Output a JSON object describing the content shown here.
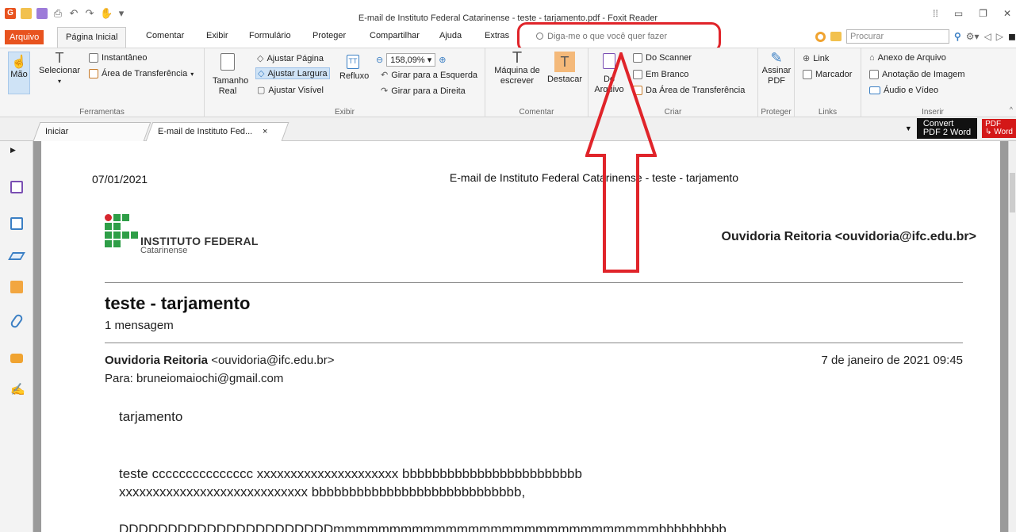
{
  "window": {
    "title": "E-mail de Instituto Federal Catarinense - teste - tarjamento.pdf - Foxit Reader"
  },
  "qat": {
    "app_letter": "G",
    "undo": "↶",
    "redo": "↷",
    "hand": "✋",
    "more": "▾"
  },
  "tabs": {
    "file": "Arquivo",
    "active": "Página Inicial",
    "items": [
      "Comentar",
      "Exibir",
      "Formulário",
      "Proteger",
      "Compartilhar",
      "Ajuda",
      "Extras"
    ],
    "tell_me": "Diga-me o que você quer fazer",
    "search_placeholder": "Procurar"
  },
  "ribbon": {
    "ferramentas": {
      "label": "Ferramentas",
      "mao": "Mão",
      "selecionar": "Selecionar",
      "instantaneo": "Instantâneo",
      "area": "Área de Transferência"
    },
    "exibir": {
      "label": "Exibir",
      "tamanho": "Tamanho",
      "real": "Real",
      "ajustar_pagina": "Ajustar Página",
      "ajustar_largura": "Ajustar Largura",
      "ajustar_visivel": "Ajustar Visível",
      "refluxo": "Refluxo",
      "zoom": "158,09%",
      "girar_esq": "Girar para a Esquerda",
      "girar_dir": "Girar para a Direita"
    },
    "comentar": {
      "label": "Comentar",
      "maquina1": "Máquina de",
      "maquina2": "escrever",
      "destacar": "Destacar"
    },
    "criar": {
      "label": "Criar",
      "do1": "Do",
      "do2": "Arquivo",
      "scanner": "Do Scanner",
      "branco": "Em Branco",
      "area": "Da Área de Transferência"
    },
    "proteger": {
      "label": "Proteger",
      "assinar1": "Assinar",
      "assinar2": "PDF"
    },
    "links": {
      "label": "Links",
      "link": "Link",
      "marcador": "Marcador"
    },
    "inserir": {
      "label": "Inserir",
      "anexo": "Anexo de Arquivo",
      "anotacao": "Anotação de Imagem",
      "audio": "Áudio e Vídeo"
    }
  },
  "doctabs": {
    "start": "Iniciar",
    "document": "E-mail de Instituto Fed...",
    "close": "×",
    "convert1": "Convert",
    "convert2": "PDF 2 Word",
    "pdf": "PDF",
    "word": "↳ Word"
  },
  "pdf": {
    "date": "07/01/2021",
    "header": "E-mail de Instituto Federal Catarinense - teste - tarjamento",
    "logo_name": "INSTITUTO FEDERAL",
    "logo_sub": "Catarinense",
    "ouvidoria_right": "Ouvidoria Reitoria <ouvidoria@ifc.edu.br>",
    "subject": "teste - tarjamento",
    "count": "1 mensagem",
    "from_name": "Ouvidoria Reitoria",
    "from_email": " <ouvidoria@ifc.edu.br>",
    "to": "Para: bruneiomaiochi@gmail.com",
    "datetime": "7 de janeiro de 2021 09:45",
    "body": [
      "tarjamento",
      "teste ccccccccccccccc xxxxxxxxxxxxxxxxxxxxx bbbbbbbbbbbbbbbbbbbbbbbb",
      "xxxxxxxxxxxxxxxxxxxxxxxxxxxx bbbbbbbbbbbbbbbbbbbbbbbbbbbb,",
      "DDDDDDDDDDDDDDDDDDDDDDmmmmmmmmmmmmmmmmmmmmmmmmmmmmmbbbbbbbbb"
    ]
  },
  "colors": {
    "brand": "#e8531f",
    "annotation_red": "#e0242a",
    "selected_blue": "#cfe3f6"
  }
}
